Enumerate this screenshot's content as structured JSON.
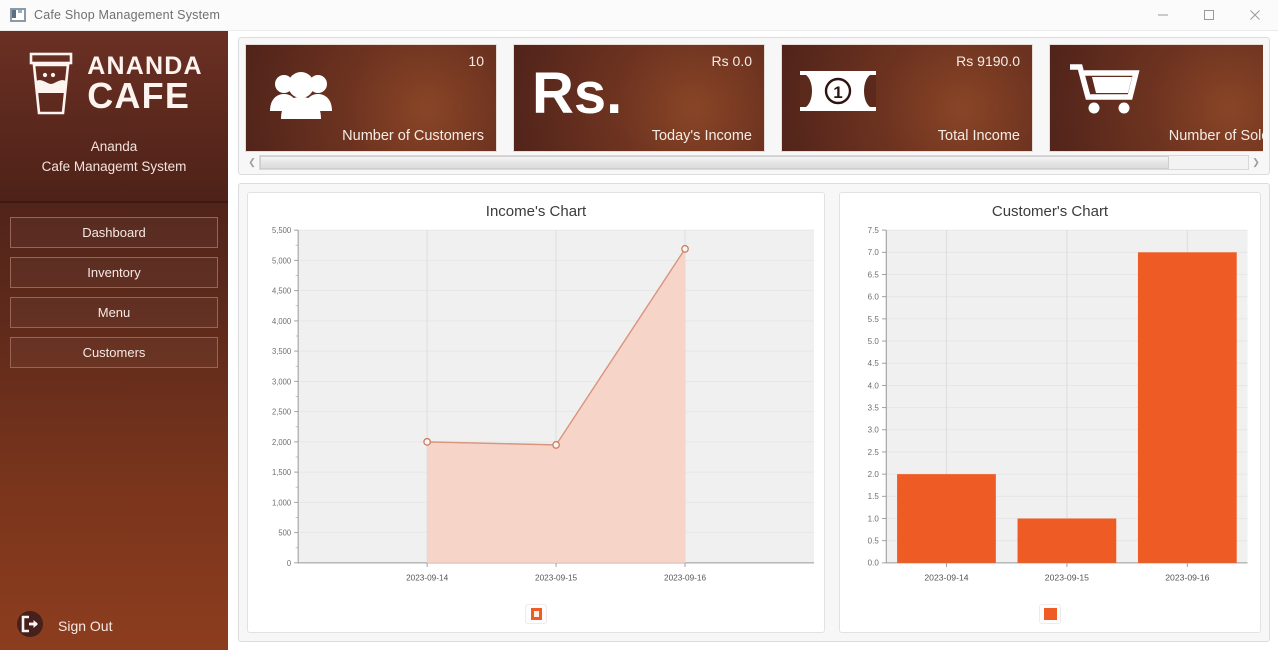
{
  "window": {
    "title": "Cafe Shop Management System",
    "icon": "app-window-icon",
    "controls": {
      "minimize": "minimize-icon",
      "maximize": "maximize-icon",
      "close": "close-icon"
    }
  },
  "sidebar": {
    "brand": {
      "logo_icon": "coffee-cup-icon",
      "word_line1": "ANANDA",
      "word_line2": "CAFE",
      "subtitle_line1": "Ananda",
      "subtitle_line2": "Cafe Managemt System"
    },
    "items": [
      {
        "label": "Dashboard",
        "name": "sidebar-item-dashboard"
      },
      {
        "label": "Inventory",
        "name": "sidebar-item-inventory"
      },
      {
        "label": "Menu",
        "name": "sidebar-item-menu"
      },
      {
        "label": "Customers",
        "name": "sidebar-item-customers"
      }
    ],
    "signout": {
      "label": "Sign Out",
      "icon": "sign-out-icon"
    },
    "colors": {
      "top": "#4b2119",
      "bottom": "#8d3d1e"
    }
  },
  "cards": [
    {
      "value": "10",
      "label": "Number of Customers",
      "icon": "people-group-icon"
    },
    {
      "value": "Rs 0.0",
      "label": "Today's Income",
      "icon": "rupee-text-icon"
    },
    {
      "value": "Rs 9190.0",
      "label": "Total Income",
      "icon": "banknote-icon"
    },
    {
      "value": "",
      "label": "Number of Sold Pr",
      "icon": "shopping-cart-icon"
    }
  ],
  "cards_scrollbar": {
    "left_arrow": "chevron-left-icon",
    "right_arrow": "chevron-right-icon",
    "thumb_percent": 92
  },
  "chart_data": [
    {
      "type": "area",
      "title": "Income's Chart",
      "categories": [
        "2023-09-14",
        "2023-09-15",
        "2023-09-16"
      ],
      "values": [
        2000,
        1950,
        5190
      ],
      "xlabel": "",
      "ylabel": "",
      "ylim": [
        0,
        5500
      ],
      "ytick_labels": [
        "0",
        "500",
        "1,000",
        "1,500",
        "2,000",
        "2,500",
        "3,000",
        "3,500",
        "4,000",
        "4,500",
        "5,000",
        "5,500"
      ],
      "ytick_values": [
        0,
        500,
        1000,
        1500,
        2000,
        2500,
        3000,
        3500,
        4000,
        4500,
        5000,
        5500
      ],
      "grid": true,
      "legend_position": "bottom",
      "legend_marker": "ring",
      "colors": {
        "line": "#d9957f",
        "fill": "#f6d4c8",
        "plot_bg": "#f0f0f0",
        "marker": "#c98163"
      }
    },
    {
      "type": "bar",
      "title": "Customer's Chart",
      "categories": [
        "2023-09-14",
        "2023-09-15",
        "2023-09-16"
      ],
      "values": [
        2.0,
        1.0,
        7.0
      ],
      "xlabel": "",
      "ylabel": "",
      "ylim": [
        0.0,
        7.5
      ],
      "ytick_labels": [
        "0.0",
        "0.5",
        "1.0",
        "1.5",
        "2.0",
        "2.5",
        "3.0",
        "3.5",
        "4.0",
        "4.5",
        "5.0",
        "5.5",
        "6.0",
        "6.5",
        "7.0",
        "7.5"
      ],
      "ytick_values": [
        0,
        0.5,
        1,
        1.5,
        2,
        2.5,
        3,
        3.5,
        4,
        4.5,
        5,
        5.5,
        6,
        6.5,
        7,
        7.5
      ],
      "grid": true,
      "legend_position": "bottom",
      "legend_marker": "solid",
      "colors": {
        "bar": "#ef5b24",
        "plot_bg": "#f0f0f0"
      }
    }
  ]
}
